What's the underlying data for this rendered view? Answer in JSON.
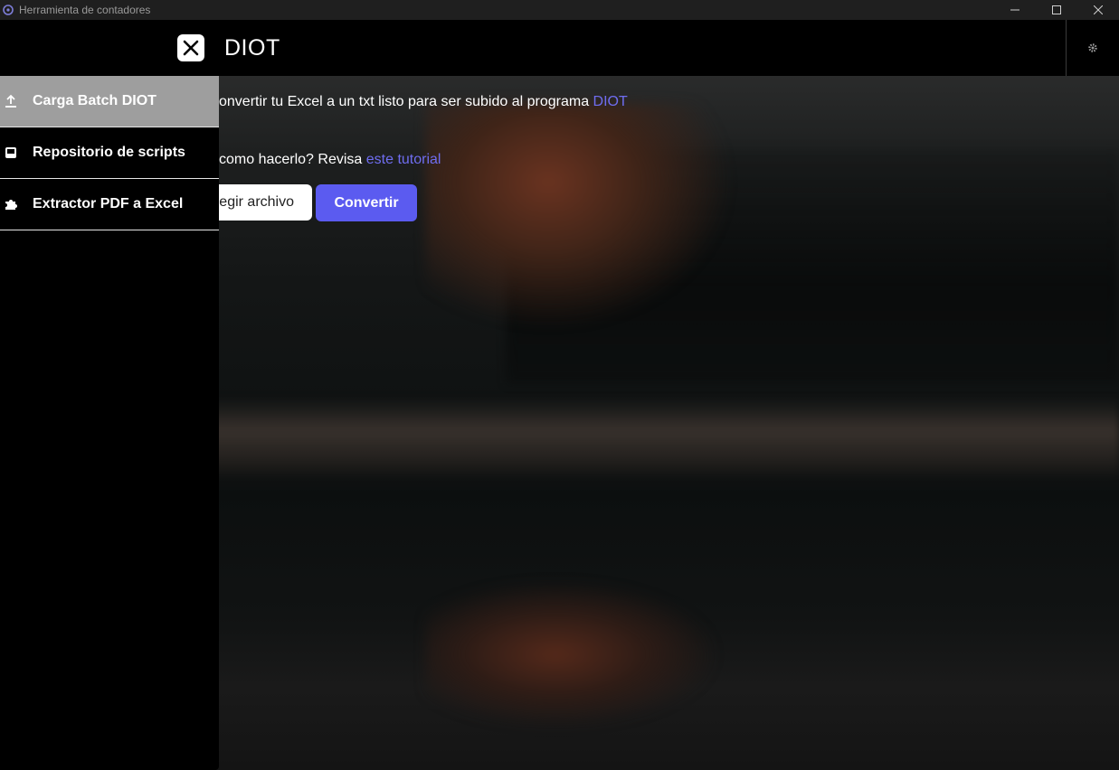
{
  "window": {
    "title": "Herramienta de contadores"
  },
  "header": {
    "title": "DIOT"
  },
  "sidebar": {
    "items": [
      {
        "label": "Carga Batch DIOT",
        "icon": "upload-icon",
        "active": true
      },
      {
        "label": "Repositorio de scripts",
        "icon": "inbox-icon",
        "active": false
      },
      {
        "label": "Extractor PDF a Excel",
        "icon": "puzzle-icon",
        "active": false
      }
    ]
  },
  "main": {
    "intro_text": "onvertir tu Excel a un txt listo para ser subido al programa ",
    "intro_link": "DIOT",
    "help_text": "como hacerlo? Revisa ",
    "help_link": "este tutorial",
    "choose_file_label": "egir archivo",
    "convert_label": "Convertir"
  },
  "colors": {
    "accent": "#5b5bf0",
    "link": "#6f6df0",
    "sidebar_active": "#9e9e9e"
  }
}
